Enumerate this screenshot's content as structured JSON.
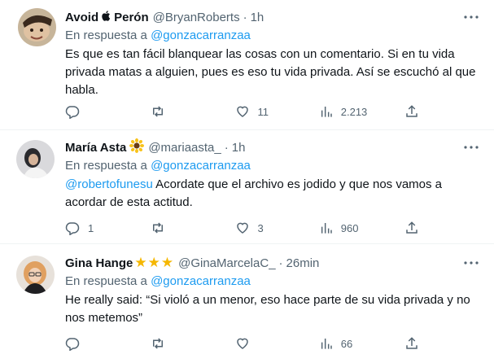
{
  "tweets": [
    {
      "name": "Avoid",
      "name_suffix": "Perón",
      "handle": "@BryanRoberts",
      "dot": "·",
      "time": "1h",
      "reply_prefix": "En respuesta a",
      "reply_handle": "@gonzacarranzaa",
      "text": "Es que es tan fácil blanquear las cosas con un comentario. Si en tu vida privada matas a alguien, pues es eso tu vida privada. Así se escuchó al que habla.",
      "replies": "",
      "retweets": "",
      "likes": "11",
      "views": "2.213"
    },
    {
      "name": "María Asta",
      "handle": "@mariaasta_",
      "dot": "·",
      "time": "1h",
      "reply_prefix": "En respuesta a",
      "reply_handle": "@gonzacarranzaa",
      "mention": "@robertofunesu",
      "text": "Acordate que el archivo es jodido y que nos vamos a acordar de esta actitud.",
      "replies": "1",
      "retweets": "",
      "likes": "3",
      "views": "960"
    },
    {
      "name": "Gina Hange",
      "stars": "★★★",
      "handle": "@GinaMarcelaC_",
      "dot": "·",
      "time": "26min",
      "reply_prefix": "En respuesta a",
      "reply_handle": "@gonzacarranzaa",
      "text": "He really said: “Si violó a un menor, eso hace parte de su vida privada y no nos metemos”",
      "replies": "",
      "retweets": "",
      "likes": "",
      "views": "66"
    }
  ],
  "colors": {
    "text": "#0f1419",
    "secondary": "#536471",
    "link": "#1d9bf0",
    "divider": "#eff3f4",
    "star": "#f5b700"
  }
}
